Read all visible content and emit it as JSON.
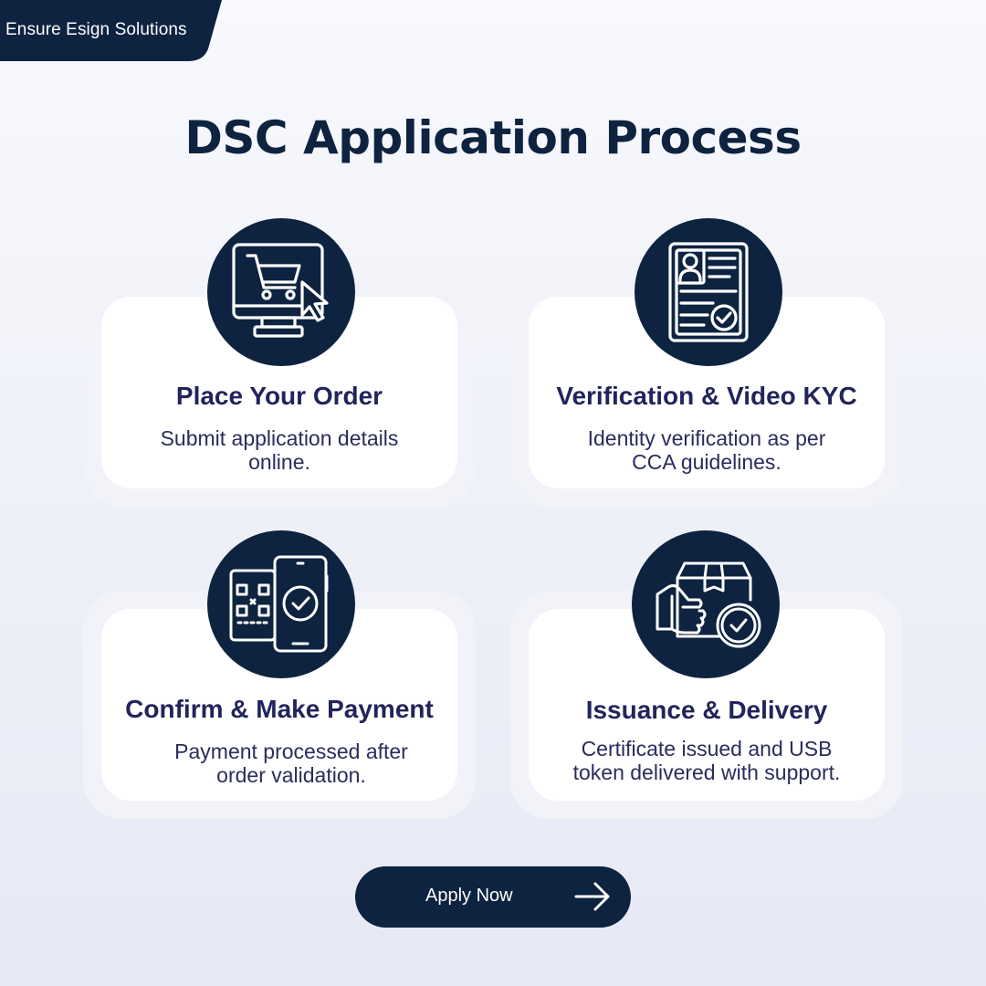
{
  "brand": {
    "name": "Ensure Esign Solutions"
  },
  "page_title": "DSC Application Process",
  "steps": [
    {
      "title": "Place Your Order",
      "desc_lines": [
        "Submit application details",
        "online."
      ],
      "icon": "shopping-cart-monitor-icon"
    },
    {
      "title": "Verification & Video KYC",
      "desc_lines": [
        "Identity verification as per",
        "CCA guidelines."
      ],
      "icon": "id-document-check-icon"
    },
    {
      "title": "Confirm & Make Payment",
      "desc_lines": [
        "Payment processed after",
        "order validation."
      ],
      "icon": "qr-phone-payment-icon"
    },
    {
      "title": "Issuance & Delivery",
      "desc_lines": [
        "Certificate issued and USB",
        "token delivered with support."
      ],
      "icon": "package-delivery-icon"
    }
  ],
  "cta": {
    "label": "Apply Now",
    "icon": "arrow-right-icon"
  },
  "colors": {
    "navy": "#0d2340",
    "heading": "#22245c",
    "card": "#ffffff",
    "card_border": "#f2f3f9"
  }
}
